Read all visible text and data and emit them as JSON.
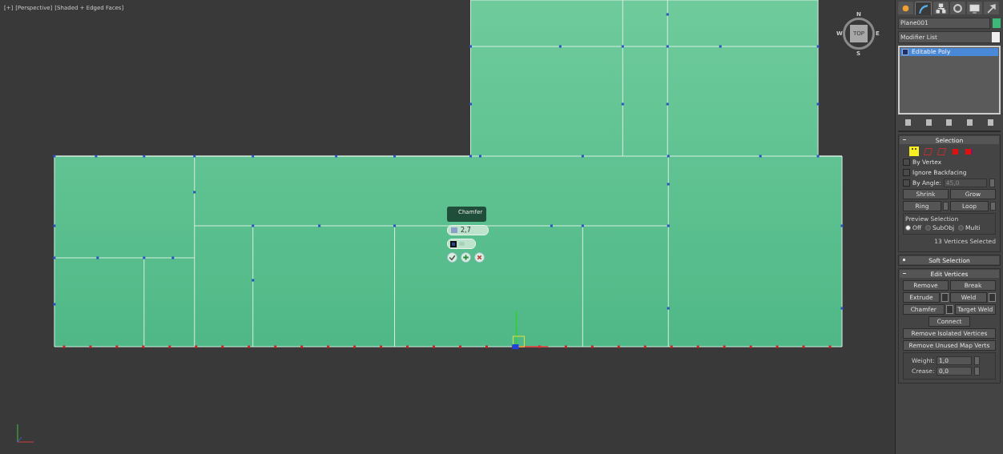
{
  "viewport": {
    "labels": [
      "[+]",
      "[Perspective]",
      "[Shaded + Edged Faces]"
    ],
    "viewcube": {
      "face": "TOP",
      "north": "N",
      "east": "E",
      "south": "S",
      "west": "W"
    },
    "caddy": {
      "title": "Chamfer",
      "value": "2,7",
      "group_on": true
    }
  },
  "command_panel": {
    "tabs": [
      {
        "kind": "create",
        "selected": false
      },
      {
        "kind": "modify",
        "selected": true
      },
      {
        "kind": "hierarchy",
        "selected": false
      },
      {
        "kind": "motion",
        "selected": false
      },
      {
        "kind": "display",
        "selected": false
      },
      {
        "kind": "utilities",
        "selected": false
      }
    ],
    "object_name": "Plane001",
    "modifier_list": "Modifier List",
    "stack": [
      {
        "label": "Editable Poly",
        "selected": true
      }
    ],
    "selection": {
      "title": "Selection",
      "expanded": true,
      "modes": [
        {
          "kind": "vertex",
          "selected": true
        },
        {
          "kind": "edge",
          "selected": false
        },
        {
          "kind": "border",
          "selected": false
        },
        {
          "kind": "polygon",
          "selected": false
        },
        {
          "kind": "element",
          "selected": false
        }
      ],
      "by_vertex": {
        "label": "By Vertex",
        "checked": false
      },
      "ignore_backfacing": {
        "label": "Ignore Backfacing",
        "checked": false
      },
      "by_angle": {
        "label": "By Angle:",
        "checked": false,
        "value": "45,0",
        "disabled": true
      },
      "shrink": "Shrink",
      "grow": "Grow",
      "ring": "Ring",
      "loop": "Loop",
      "preview": {
        "title": "Preview Selection",
        "options": [
          {
            "label": "Off",
            "selected": true
          },
          {
            "label": "SubObj",
            "selected": false
          },
          {
            "label": "Multi",
            "selected": false
          }
        ]
      },
      "status": "13 Vertices Selected"
    },
    "soft_selection": {
      "title": "Soft Selection",
      "expanded": false
    },
    "edit_vertices": {
      "title": "Edit Vertices",
      "expanded": true,
      "rows": [
        [
          {
            "label": "Remove",
            "settings": false
          },
          {
            "label": "Break",
            "settings": false
          }
        ],
        [
          {
            "label": "Extrude",
            "settings": true
          },
          {
            "label": "Weld",
            "settings": true
          }
        ],
        [
          {
            "label": "Chamfer",
            "settings": true
          },
          {
            "label": "Target Weld",
            "settings": false
          }
        ]
      ],
      "connect": "Connect",
      "remove_isolated": "Remove Isolated Vertices",
      "remove_unused": "Remove Unused Map Verts",
      "weight": {
        "label": "Weight:",
        "value": "1,0"
      },
      "crease": {
        "label": "Crease:",
        "value": "0,0"
      }
    }
  }
}
